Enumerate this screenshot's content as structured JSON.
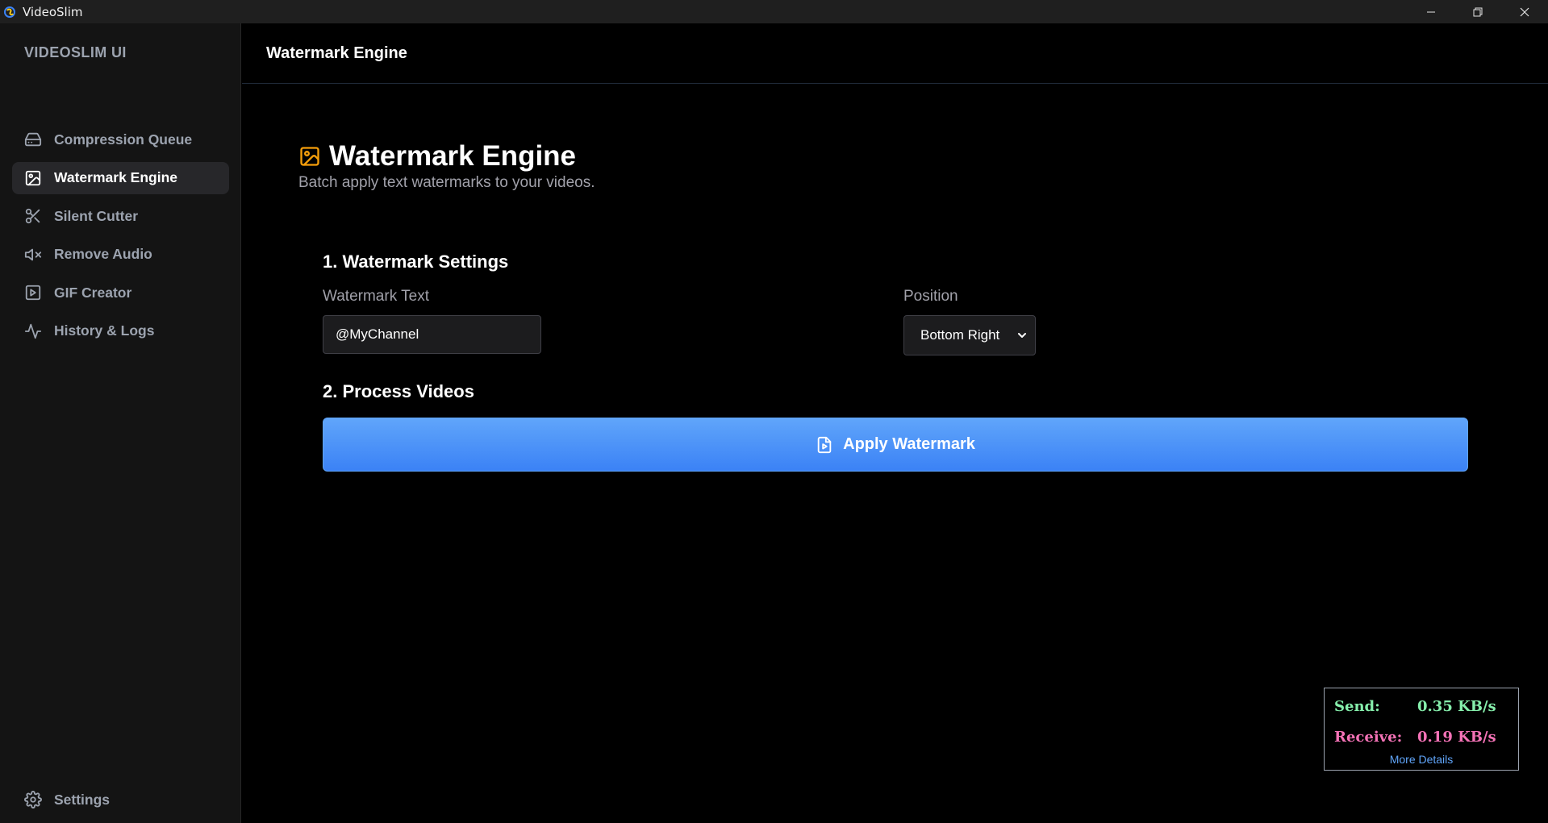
{
  "window": {
    "title": "VideoSlim",
    "controls": {
      "minimize": "minimize-icon",
      "restore": "restore-icon",
      "close": "close-icon"
    }
  },
  "sidebar": {
    "brand": "VIDEOSLIM UI",
    "items": [
      {
        "label": "Compression Queue",
        "icon": "hard-drive-icon",
        "active": false
      },
      {
        "label": "Watermark Engine",
        "icon": "image-icon",
        "active": true
      },
      {
        "label": "Silent Cutter",
        "icon": "scissors-icon",
        "active": false
      },
      {
        "label": "Remove Audio",
        "icon": "volume-mute-icon",
        "active": false
      },
      {
        "label": "GIF Creator",
        "icon": "play-square-icon",
        "active": false
      },
      {
        "label": "History & Logs",
        "icon": "activity-icon",
        "active": false
      }
    ],
    "settings_label": "Settings"
  },
  "topbar": {
    "title": "Watermark Engine"
  },
  "page": {
    "title": "Watermark Engine",
    "subtitle": "Batch apply text watermarks to your videos.",
    "accent_color": "#f59e0b"
  },
  "settings_section": {
    "title": "1. Watermark Settings",
    "text_label": "Watermark Text",
    "text_value": "@MyChannel",
    "position_label": "Position",
    "position_value": "Bottom Right"
  },
  "process_section": {
    "title": "2. Process Videos",
    "apply_label": "Apply Watermark",
    "button_color": "#3b82f6"
  },
  "network": {
    "send_label": "Send:",
    "send_value": "0.35 KB/s",
    "receive_label": "Receive:",
    "receive_value": "0.19 KB/s",
    "more_label": "More Details",
    "send_color": "#86efac",
    "receive_color": "#f472b6"
  }
}
